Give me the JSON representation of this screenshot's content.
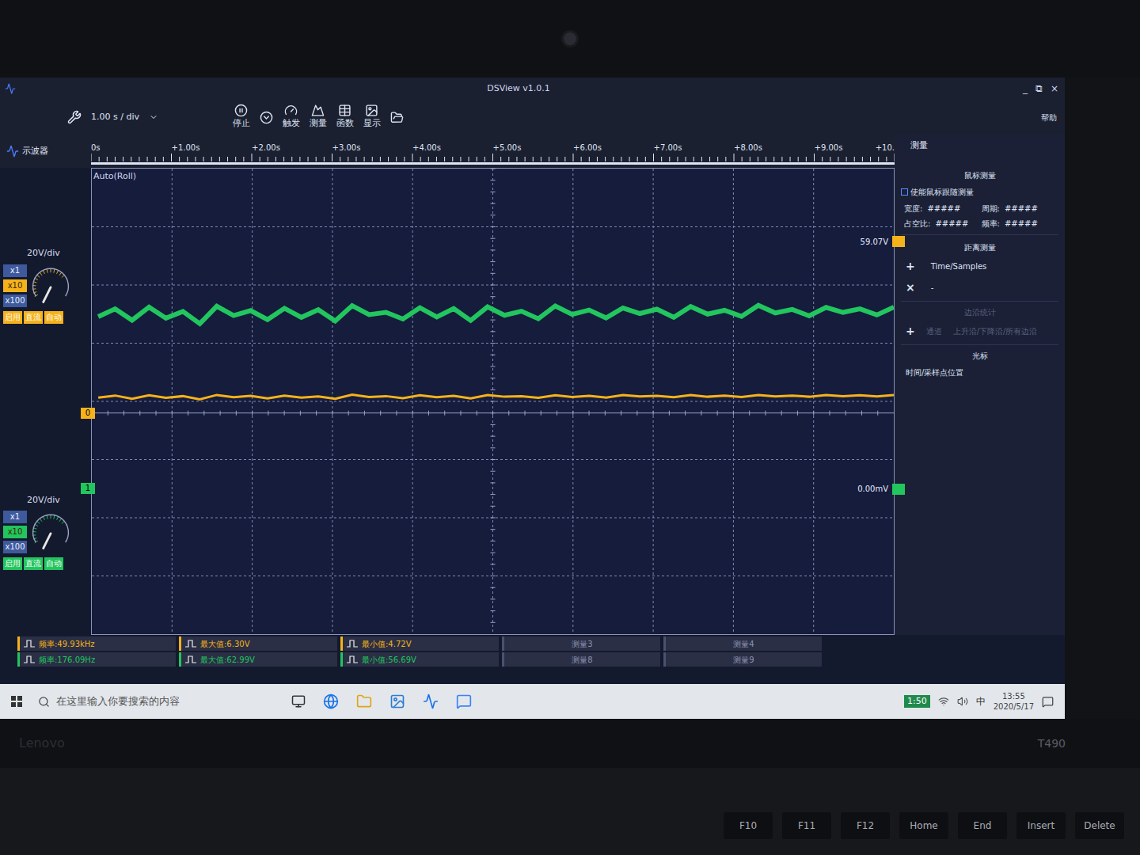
{
  "window": {
    "title": "DSView v1.0.1",
    "controls": [
      "_",
      "⧉",
      "×"
    ]
  },
  "toolbar": {
    "timebase": "1.00 s / div",
    "buttons": [
      "停止",
      "触发",
      "测量",
      "函数",
      "显示"
    ],
    "help": "帮助"
  },
  "mode_tab": "示波器",
  "ruler": {
    "ticks": [
      "0s",
      "+1.00s",
      "+2.00s",
      "+3.00s",
      "+4.00s",
      "+5.00s",
      "+6.00s",
      "+7.00s",
      "+8.00s",
      "+9.00s",
      "+10."
    ]
  },
  "plot": {
    "mode": "Auto(Roll)"
  },
  "channels": [
    {
      "id": "0",
      "color": "#f5b21a",
      "volts_per_div": "20V/div",
      "probe": [
        {
          "label": "x1",
          "selected": false
        },
        {
          "label": "x10",
          "selected": true
        },
        {
          "label": "x100",
          "selected": false
        }
      ],
      "toggles": [
        {
          "label": "启用",
          "on": true
        },
        {
          "label": "直流",
          "on": true
        },
        {
          "label": "自动",
          "on": true
        }
      ],
      "trigger": {
        "label": "59.07V",
        "value": 59.07
      },
      "values": [
        5.3,
        6.0,
        4.9,
        6.1,
        5.2,
        5.8,
        4.72,
        6.2,
        5.4,
        5.9,
        5.0,
        6.0,
        5.3,
        5.7,
        4.9,
        6.3,
        5.5,
        5.8,
        5.1,
        6.1,
        5.4,
        5.9,
        5.0,
        6.2,
        5.6,
        5.8,
        5.2,
        6.1,
        5.5,
        5.9,
        5.3,
        6.2,
        5.7,
        5.9,
        5.4,
        6.2,
        5.6,
        6.0,
        5.5,
        6.2,
        5.7,
        6.0,
        5.6,
        6.2,
        5.8,
        6.1,
        5.7,
        6.2
      ]
    },
    {
      "id": "1",
      "color": "#22c55e",
      "volts_per_div": "20V/div",
      "probe": [
        {
          "label": "x1",
          "selected": false
        },
        {
          "label": "x10",
          "selected": true
        },
        {
          "label": "x100",
          "selected": false
        }
      ],
      "toggles": [
        {
          "label": "启用",
          "on": true
        },
        {
          "label": "直流",
          "on": true
        },
        {
          "label": "自动",
          "on": true
        }
      ],
      "trigger": {
        "label": "0.00mV",
        "value": 0
      },
      "values": [
        59.1,
        61.8,
        57.9,
        62.4,
        58.6,
        60.9,
        56.69,
        62.7,
        59.5,
        61.2,
        58.1,
        62.0,
        58.9,
        61.5,
        57.6,
        62.9,
        59.8,
        60.6,
        58.3,
        62.2,
        59.0,
        61.9,
        57.8,
        62.5,
        59.6,
        61.0,
        58.4,
        62.8,
        59.9,
        61.4,
        58.7,
        62.1,
        60.2,
        61.7,
        58.9,
        62.6,
        60.0,
        61.3,
        59.2,
        62.99,
        60.4,
        61.6,
        59.4,
        62.3,
        60.6,
        61.8,
        59.7,
        62.4
      ]
    }
  ],
  "measure_panel": {
    "title": "测量",
    "mouse": {
      "title": "鼠标测量",
      "follow": {
        "label": "使能鼠标跟随测量",
        "checked": false
      },
      "fields": [
        {
          "label": "宽度:",
          "value": "#####"
        },
        {
          "label": "周期:",
          "value": "#####"
        },
        {
          "label": "占空比:",
          "value": "#####"
        },
        {
          "label": "频率:",
          "value": "#####"
        }
      ]
    },
    "distance": {
      "title": "距离测量",
      "add": "+",
      "remove": "×",
      "column": "Time/Samples",
      "value": "-"
    },
    "edges": {
      "title": "边沿统计",
      "add": "+",
      "channel": "通道",
      "kinds": "上升沿/下降沿/所有边沿",
      "disabled": true
    },
    "cursor": {
      "title": "光标",
      "label": "时间/采样点位置"
    }
  },
  "measurements": [
    {
      "color": "#f5b21a",
      "cells": [
        {
          "text": "频率:49.93kHz",
          "assigned": true
        },
        {
          "text": "最大值:6.30V",
          "assigned": true
        },
        {
          "text": "最小值:4.72V",
          "assigned": true
        },
        {
          "text": "测量3",
          "assigned": false
        },
        {
          "text": "测量4",
          "assigned": false
        }
      ]
    },
    {
      "color": "#22c55e",
      "cells": [
        {
          "text": "频率:176.09Hz",
          "assigned": true
        },
        {
          "text": "最大值:62.99V",
          "assigned": true
        },
        {
          "text": "最小值:56.69V",
          "assigned": true
        },
        {
          "text": "测量8",
          "assigned": false
        },
        {
          "text": "测量9",
          "assigned": false
        }
      ]
    }
  ],
  "taskbar": {
    "search": "在这里输入你要搜索的内容",
    "badge": "1:50",
    "ime": "中",
    "time": "13:55",
    "date": "2020/5/17"
  },
  "laptop": {
    "brand": "Lenovo",
    "model": "T490",
    "keys": [
      "F10",
      "F11",
      "F12",
      "Home",
      "End",
      "Insert",
      "Delete"
    ]
  }
}
